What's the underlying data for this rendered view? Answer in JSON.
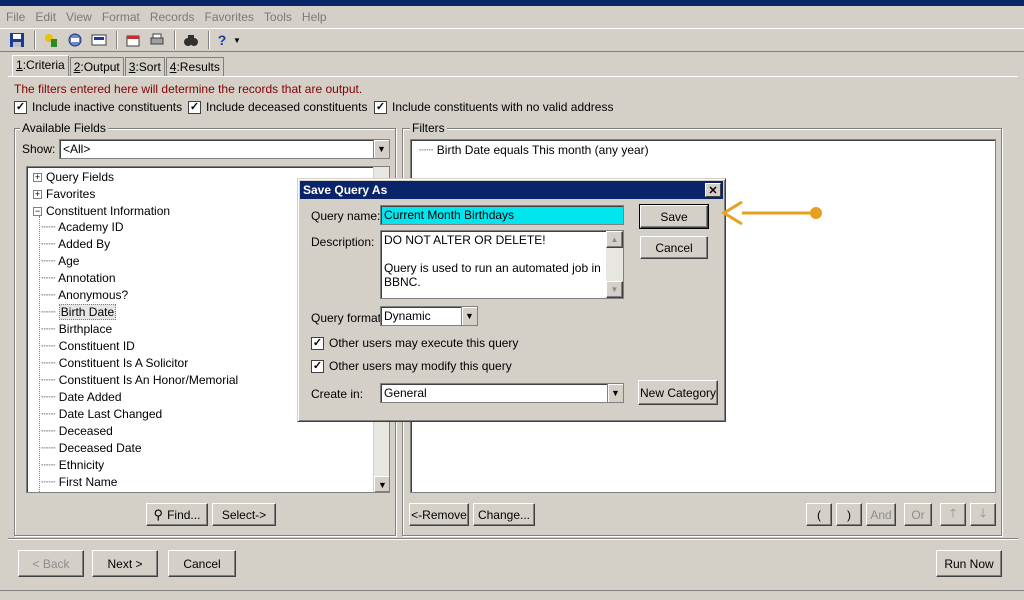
{
  "menu": [
    "File",
    "Edit",
    "View",
    "Format",
    "Records",
    "Favorites",
    "Tools",
    "Help"
  ],
  "toolbar_icons": [
    "save-icon",
    "export-icon",
    "preview-icon",
    "print-setup-icon",
    "properties-icon",
    "print-icon",
    "find-icon",
    "help-icon"
  ],
  "tabs": [
    {
      "num": "1",
      "label": ":Criteria"
    },
    {
      "num": "2",
      "label": ":Output"
    },
    {
      "num": "3",
      "label": ":Sort"
    },
    {
      "num": "4",
      "label": ":Results"
    }
  ],
  "info_text": "The filters entered here will determine the records that are output.",
  "options": {
    "inactive": "Include inactive constituents",
    "deceased": "Include deceased constituents",
    "no_address": "Include constituents with no valid address"
  },
  "available": {
    "label": "Available Fields",
    "show_label": "Show:",
    "show_value": "<All>",
    "roots": [
      "Query Fields",
      "Favorites",
      "Constituent Information"
    ],
    "children": [
      "Academy ID",
      "Added By",
      "Age",
      "Annotation",
      "Anonymous?",
      "Birth Date",
      "Birthplace",
      "Constituent ID",
      "Constituent Is A Solicitor",
      "Constituent Is An Honor/Memorial",
      "Date Added",
      "Date Last Changed",
      "Deceased",
      "Deceased Date",
      "Ethnicity",
      "First Name"
    ],
    "find": "Find...",
    "select": "Select->"
  },
  "filters": {
    "label": "Filters",
    "item": "Birth Date equals This month (any year)",
    "remove": "<-Remove",
    "change": "Change...",
    "open_paren": "(",
    "close_paren": ")",
    "and": "And",
    "or": "Or"
  },
  "nav": {
    "back": "< Back",
    "next": "Next >",
    "cancel": "Cancel",
    "run": "Run Now"
  },
  "dialog": {
    "title": "Save Query As",
    "name_label": "Query name:",
    "name_value": "Current Month Birthdays",
    "desc_label": "Description:",
    "desc_line1": "DO NOT ALTER OR DELETE!",
    "desc_line2": "Query is used to run an automated job in",
    "desc_line3": "BBNC.",
    "format_label": "Query format:",
    "format_value": "Dynamic",
    "execute": "Other users may execute this query",
    "modify": "Other users may modify this query",
    "create_label": "Create in:",
    "create_value": "General",
    "save": "Save",
    "cancel": "Cancel",
    "new_category": "New Category"
  },
  "colors": {
    "highlight": "#00e5ee",
    "arrow": "#e8a020",
    "title_bar": "#0a246a"
  }
}
